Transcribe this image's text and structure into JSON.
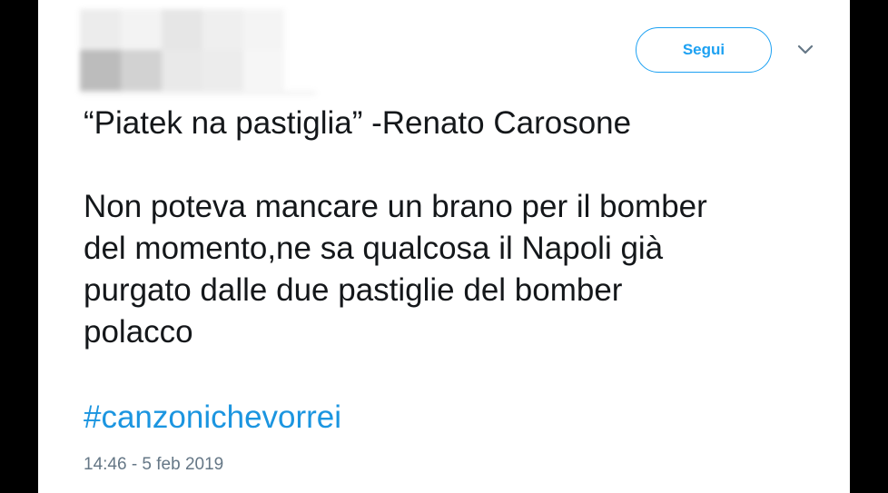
{
  "tweet": {
    "follow_label": "Segui",
    "text": "“Piatek na pastiglia” -Renato Carosone\n\nNon poteva mancare un brano per il bomber\ndel momento,ne sa qualcosa il Napoli già\npurgato dalle due pastiglie del bomber\npolacco",
    "hashtag": "#canzonichevorrei",
    "timestamp": "14:46 - 5 feb 2019"
  },
  "colors": {
    "accent": "#1da1f2",
    "hashtag": "#1b95e0",
    "text": "#14171a",
    "muted": "#657786"
  },
  "icons": {
    "more": "chevron-down-icon"
  }
}
